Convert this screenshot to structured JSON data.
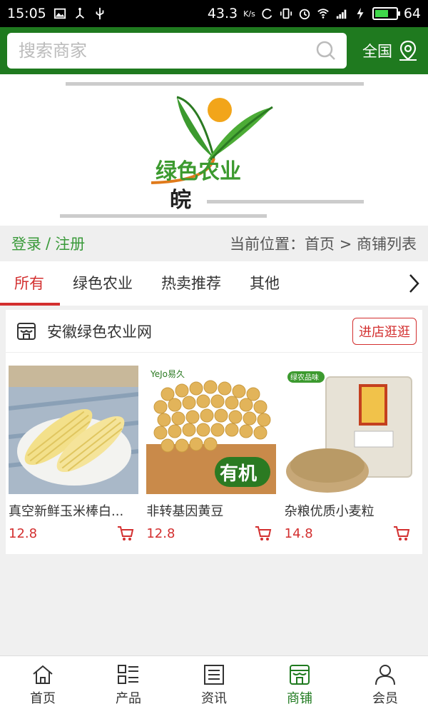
{
  "status_bar": {
    "time": "15:05",
    "net_speed": "43.3",
    "net_unit": "K/s",
    "battery": "64",
    "battery_level": 0.64,
    "icons_left": [
      "image-icon",
      "usb-share-icon",
      "usb-icon"
    ],
    "icons_right": [
      "sync-icon",
      "vibrate-icon",
      "alarm-icon",
      "wifi-icon",
      "signal-4g-icon",
      "charging-icon",
      "battery-icon"
    ]
  },
  "header": {
    "search_placeholder": "搜索商家",
    "region_label": "全国"
  },
  "banner": {
    "logo_text": "绿色农业",
    "logo_sub": "皖"
  },
  "login_bar": {
    "login": "登录",
    "separator": "/",
    "register": "注册",
    "location_label": "当前位置：",
    "breadcrumb_home": "首页",
    "breadcrumb_sep": ">",
    "breadcrumb_current": "商铺列表"
  },
  "tabs": [
    {
      "label": "所有",
      "active": true
    },
    {
      "label": "绿色农业",
      "active": false
    },
    {
      "label": "热卖推荐",
      "active": false
    },
    {
      "label": "其他",
      "active": false
    }
  ],
  "shop": {
    "name": "安徽绿色农业网",
    "enter_label": "进店逛逛",
    "products": [
      {
        "name": "真空新鲜玉米棒白...",
        "price": "12.8"
      },
      {
        "name": "非转基因黄豆",
        "price": "12.8",
        "badge": "有机",
        "brand": "YeJo易久"
      },
      {
        "name": "杂粮优质小麦粒",
        "price": "14.8",
        "badge": "绿农品味"
      }
    ]
  },
  "bottom_nav": [
    {
      "label": "首页",
      "icon": "home-icon",
      "active": false
    },
    {
      "label": "产品",
      "icon": "grid-list-icon",
      "active": false
    },
    {
      "label": "资讯",
      "icon": "news-icon",
      "active": false
    },
    {
      "label": "商铺",
      "icon": "shop-icon",
      "active": true
    },
    {
      "label": "会员",
      "icon": "user-icon",
      "active": false
    }
  ],
  "colors": {
    "brand_green": "#1f7a1f",
    "accent_red": "#d32f2f",
    "link_green": "#3a9a3a"
  }
}
